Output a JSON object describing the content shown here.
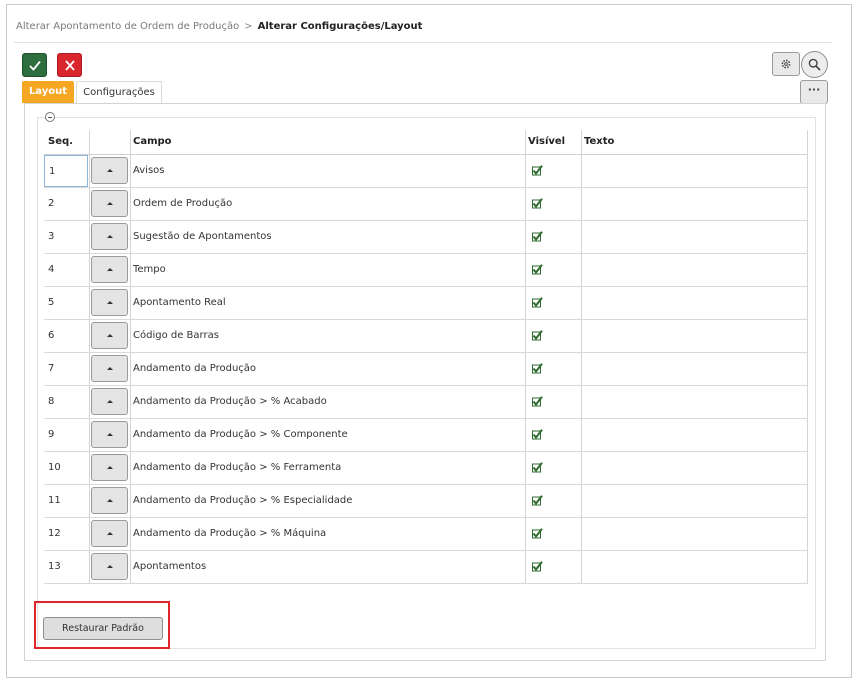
{
  "breadcrumb": {
    "parent": "Alterar Apontamento de Ordem de Produção",
    "separator": ">",
    "current": "Alterar Configurações/Layout"
  },
  "toolbar": {
    "confirm_icon": "check-icon",
    "cancel_icon": "close-icon",
    "settings_icon": "gear-icon",
    "search_icon": "search-icon",
    "more_label": "···"
  },
  "tabs": [
    {
      "label": "Layout",
      "active": true
    },
    {
      "label": "Configurações",
      "active": false
    }
  ],
  "table": {
    "columns": {
      "seq": "Seq.",
      "campo": "Campo",
      "visivel": "Visível",
      "texto": "Texto"
    },
    "rows": [
      {
        "seq": "1",
        "campo": "Avisos",
        "visivel": true,
        "texto": ""
      },
      {
        "seq": "2",
        "campo": "Ordem de Produção",
        "visivel": true,
        "texto": ""
      },
      {
        "seq": "3",
        "campo": "Sugestão de Apontamentos",
        "visivel": true,
        "texto": ""
      },
      {
        "seq": "4",
        "campo": "Tempo",
        "visivel": true,
        "texto": ""
      },
      {
        "seq": "5",
        "campo": "Apontamento Real",
        "visivel": true,
        "texto": ""
      },
      {
        "seq": "6",
        "campo": "Código de Barras",
        "visivel": true,
        "texto": ""
      },
      {
        "seq": "7",
        "campo": "Andamento da Produção",
        "visivel": true,
        "texto": ""
      },
      {
        "seq": "8",
        "campo": "Andamento da Produção > % Acabado",
        "visivel": true,
        "texto": ""
      },
      {
        "seq": "9",
        "campo": "Andamento da Produção > % Componente",
        "visivel": true,
        "texto": ""
      },
      {
        "seq": "10",
        "campo": "Andamento da Produção > % Ferramenta",
        "visivel": true,
        "texto": ""
      },
      {
        "seq": "11",
        "campo": "Andamento da Produção > % Especialidade",
        "visivel": true,
        "texto": ""
      },
      {
        "seq": "12",
        "campo": "Andamento da Produção > % Máquina",
        "visivel": true,
        "texto": ""
      },
      {
        "seq": "13",
        "campo": "Apontamentos",
        "visivel": true,
        "texto": ""
      }
    ]
  },
  "restore_button_label": "Restaurar Padrão",
  "colors": {
    "accent": "#f5a623",
    "confirm": "#2e6d3e",
    "cancel": "#d9262d",
    "highlight": "#e0252b",
    "check": "#2e6b2e"
  }
}
